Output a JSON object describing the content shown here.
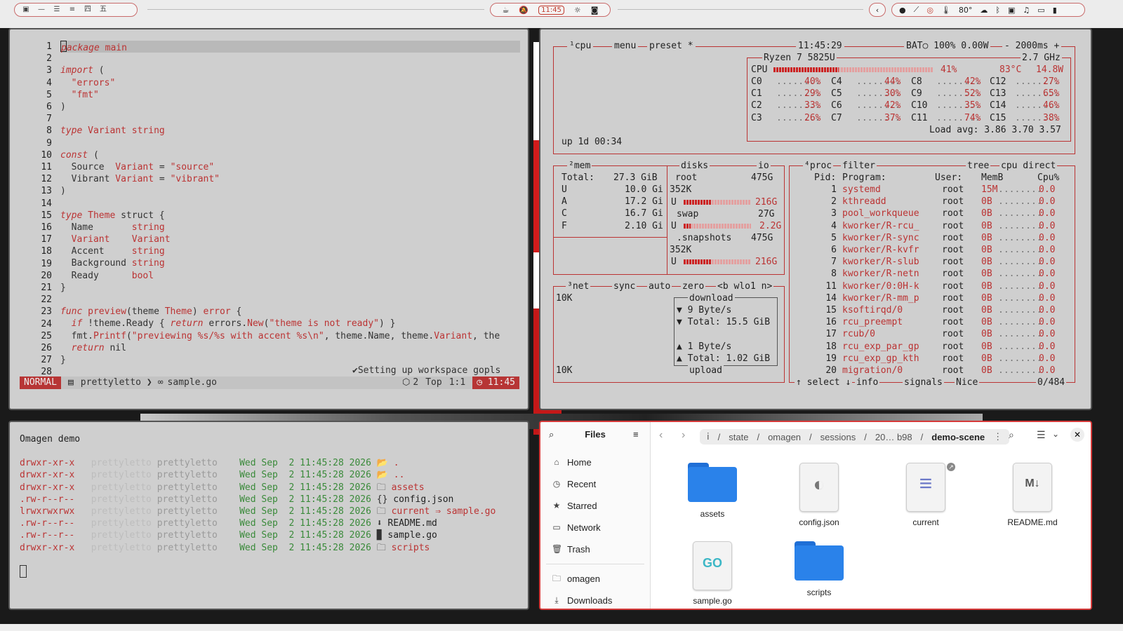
{
  "topbar": {
    "workspaces": [
      "1",
      "2",
      "3",
      "4",
      "5",
      "6"
    ],
    "clock": "11:45",
    "tray_right": "80°"
  },
  "editor": {
    "lines": [
      [
        "package main"
      ],
      [
        ""
      ],
      [
        "import ("
      ],
      [
        "  \"errors\""
      ],
      [
        "  \"fmt\""
      ],
      [
        ")"
      ],
      [
        ""
      ],
      [
        "type Variant string"
      ],
      [
        ""
      ],
      [
        "const ("
      ],
      [
        "  Source  Variant = \"source\""
      ],
      [
        "  Vibrant Variant = \"vibrant\""
      ],
      [
        ")"
      ],
      [
        ""
      ],
      [
        "type Theme struct {"
      ],
      [
        "  Name       string"
      ],
      [
        "  Variant    Variant"
      ],
      [
        "  Accent     string"
      ],
      [
        "  Background string"
      ],
      [
        "  Ready      bool"
      ],
      [
        "}"
      ],
      [
        ""
      ],
      [
        "func preview(theme Theme) error {"
      ],
      [
        "  if !theme.Ready { return errors.New(\"theme is not ready\") }"
      ],
      [
        "  fmt.Printf(\"previewing %s/%s with accent %s\\n\", theme.Name, theme.Variant, the"
      ],
      [
        "  return nil"
      ],
      [
        "}"
      ],
      [
        ""
      ]
    ],
    "lsp_message": "✔Setting up workspace gopls",
    "mode": "NORMAL",
    "project": "prettyletto",
    "file": "sample.go",
    "diag": "2",
    "position": "Top",
    "cursor": "1:1",
    "time": "11:45"
  },
  "btop": {
    "header": {
      "cpu": "¹cpu",
      "menu": "menu",
      "preset": "preset *",
      "time": "11:45:29",
      "bat": "BAT○ 100% 0.00W",
      "refresh": "- 2000ms +"
    },
    "cpu_model": "Ryzen 7 5825U",
    "freq": "2.7 GHz",
    "cpu_total": "41%",
    "cpu_temp": "83°C",
    "cpu_power": "14.8W",
    "cores": [
      [
        "C0",
        "40%"
      ],
      [
        "C1",
        "29%"
      ],
      [
        "C2",
        "33%"
      ],
      [
        "C3",
        "26%"
      ],
      [
        "C4",
        "44%"
      ],
      [
        "C5",
        "30%"
      ],
      [
        "C6",
        "42%"
      ],
      [
        "C7",
        "37%"
      ],
      [
        "C8",
        "42%"
      ],
      [
        "C9",
        "52%"
      ],
      [
        "C10",
        "35%"
      ],
      [
        "C11",
        "74%"
      ],
      [
        "C12",
        "27%"
      ],
      [
        "C13",
        "65%"
      ],
      [
        "C14",
        "46%"
      ],
      [
        "C15",
        "38%"
      ]
    ],
    "load_avg": "Load avg: 3.86 3.70 3.57",
    "uptime": "up 1d 00:34",
    "mem": {
      "title": "²mem",
      "total_label": "Total:",
      "total": "27.3 GiB",
      "rows": [
        [
          "U",
          "10.0 Gi"
        ],
        [
          "A",
          "17.2 Gi"
        ],
        [
          "C",
          "16.7 Gi"
        ],
        [
          "F",
          "2.10 Gi"
        ]
      ]
    },
    "disks": {
      "title": "disks",
      "io": "io",
      "root": "root",
      "root_size": "475G",
      "root_free": "352K",
      "root_used": "216G",
      "swap": "swap",
      "swap_size": "27G",
      "swap_used": "2.2G",
      "snap": ".snapshots",
      "snap_size": "475G",
      "snap_free": "352K",
      "snap_used": "216G",
      "u": "U"
    },
    "net": {
      "title": "³net",
      "sync": "sync",
      "auto": "auto",
      "zero": "zero",
      "iface": "<b wlo1 n>",
      "top_scale": "10K",
      "bottom_scale": "10K",
      "download": "download",
      "dl_rate": "▼ 9 Byte/s",
      "dl_total": "▼ Total: 15.5 GiB",
      "ul_rate": "▲ 1 Byte/s",
      "ul_total": "▲ Total: 1.02 GiB",
      "upload": "upload"
    },
    "proc": {
      "title": "⁴proc",
      "filter": "filter",
      "tree": "tree",
      "sort": "cpu direct",
      "headers": [
        "Pid:",
        "Program:",
        "User:",
        "MemB",
        "Cpu%"
      ],
      "rows": [
        [
          "1",
          "systemd",
          "root",
          "15M",
          "0.0"
        ],
        [
          "2",
          "kthreadd",
          "root",
          "0B",
          "0.0"
        ],
        [
          "3",
          "pool_workqueue",
          "root",
          "0B",
          "0.0"
        ],
        [
          "4",
          "kworker/R-rcu_",
          "root",
          "0B",
          "0.0"
        ],
        [
          "5",
          "kworker/R-sync",
          "root",
          "0B",
          "0.0"
        ],
        [
          "6",
          "kworker/R-kvfr",
          "root",
          "0B",
          "0.0"
        ],
        [
          "7",
          "kworker/R-slub",
          "root",
          "0B",
          "0.0"
        ],
        [
          "8",
          "kworker/R-netn",
          "root",
          "0B",
          "0.0"
        ],
        [
          "11",
          "kworker/0:0H-k",
          "root",
          "0B",
          "0.0"
        ],
        [
          "14",
          "kworker/R-mm_p",
          "root",
          "0B",
          "0.0"
        ],
        [
          "15",
          "ksoftirqd/0",
          "root",
          "0B",
          "0.0"
        ],
        [
          "16",
          "rcu_preempt",
          "root",
          "0B",
          "0.0"
        ],
        [
          "17",
          "rcub/0",
          "root",
          "0B",
          "0.0"
        ],
        [
          "18",
          "rcu_exp_par_gp",
          "root",
          "0B",
          "0.0"
        ],
        [
          "19",
          "rcu_exp_gp_kth",
          "root",
          "0B",
          "0.0"
        ],
        [
          "20",
          "migration/0",
          "root",
          "0B",
          "0.0"
        ]
      ],
      "footer": "↑ select ↓",
      "info": "info",
      "signals": "signals",
      "nice": "Nice",
      "count": "0/484"
    }
  },
  "terminal": {
    "title": "Omagen demo",
    "rows": [
      [
        "drwxr-xr-x",
        "prettyletto",
        "Wed Sep  2 11:45:28 2026",
        "📂",
        ".",
        ""
      ],
      [
        "drwxr-xr-x",
        "prettyletto",
        "Wed Sep  2 11:45:28 2026",
        "📂",
        "..",
        ""
      ],
      [
        "drwxr-xr-x",
        "prettyletto",
        "Wed Sep  2 11:45:28 2026",
        "🗀",
        "assets",
        ""
      ],
      [
        ".rw-r--r--",
        "prettyletto",
        "Wed Sep  2 11:45:28 2026",
        "{}",
        "config.json",
        ""
      ],
      [
        "lrwxrwxrwx",
        "prettyletto",
        "Wed Sep  2 11:45:28 2026",
        "🗀",
        "current",
        "⇒ sample.go"
      ],
      [
        ".rw-r--r--",
        "prettyletto",
        "Wed Sep  2 11:45:28 2026",
        "⬇",
        "README.md",
        ""
      ],
      [
        ".rw-r--r--",
        "prettyletto",
        "Wed Sep  2 11:45:28 2026",
        "▉",
        "sample.go",
        ""
      ],
      [
        "drwxr-xr-x",
        "prettyletto",
        "Wed Sep  2 11:45:28 2026",
        "🗀",
        "scripts",
        ""
      ]
    ]
  },
  "files": {
    "title": "Files",
    "sidebar": [
      "Home",
      "Recent",
      "Starred",
      "Network",
      "Trash"
    ],
    "bookmarks": [
      "omagen",
      "Downloads"
    ],
    "breadcrumbs": [
      "state",
      "omagen",
      "sessions",
      "20… b98"
    ],
    "current": "demo-scene",
    "items": [
      {
        "name": "assets",
        "kind": "folder"
      },
      {
        "name": "config.json",
        "kind": "json"
      },
      {
        "name": "current",
        "kind": "text"
      },
      {
        "name": "README.md",
        "kind": "md"
      },
      {
        "name": "sample.go",
        "kind": "go"
      },
      {
        "name": "scripts",
        "kind": "folder"
      }
    ]
  }
}
